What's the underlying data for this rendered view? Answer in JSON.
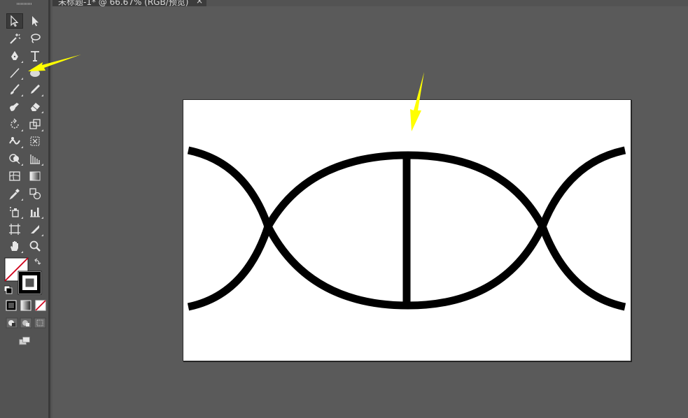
{
  "document": {
    "tab_title": "未标题-1* @ 66.67% (RGB/预览)",
    "close_glyph": "×"
  },
  "toolbar": {
    "tools": [
      {
        "name": "selection-tool-icon",
        "selected": true
      },
      {
        "name": "direct-selection-tool-icon"
      },
      {
        "name": "magic-wand-tool-icon"
      },
      {
        "name": "lasso-tool-icon"
      },
      {
        "name": "pen-tool-icon"
      },
      {
        "name": "type-tool-icon"
      },
      {
        "name": "line-segment-tool-icon"
      },
      {
        "name": "ellipse-tool-icon"
      },
      {
        "name": "paintbrush-tool-icon"
      },
      {
        "name": "pencil-tool-icon"
      },
      {
        "name": "blob-brush-tool-icon"
      },
      {
        "name": "eraser-tool-icon"
      },
      {
        "name": "rotate-tool-icon"
      },
      {
        "name": "scale-tool-icon"
      },
      {
        "name": "warp-tool-icon"
      },
      {
        "name": "free-transform-tool-icon"
      },
      {
        "name": "shape-builder-tool-icon"
      },
      {
        "name": "perspective-grid-tool-icon"
      },
      {
        "name": "mesh-tool-icon"
      },
      {
        "name": "gradient-tool-icon"
      },
      {
        "name": "eyedropper-tool-icon"
      },
      {
        "name": "blend-tool-icon"
      },
      {
        "name": "symbol-sprayer-tool-icon"
      },
      {
        "name": "column-graph-tool-icon"
      },
      {
        "name": "artboard-tool-icon"
      },
      {
        "name": "slice-tool-icon"
      },
      {
        "name": "hand-tool-icon"
      },
      {
        "name": "zoom-tool-icon"
      }
    ],
    "fill": "none",
    "stroke": "#000000"
  },
  "colors": {
    "workspace": "#535353",
    "artboard": "#ffffff",
    "stroke": "#000000",
    "annotation_arrow": "#ffff00"
  }
}
